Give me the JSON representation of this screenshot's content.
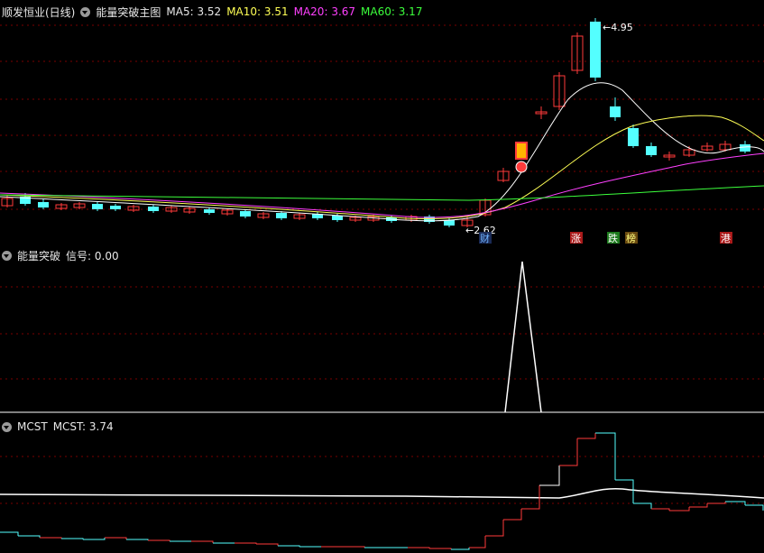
{
  "main_pane": {
    "stock_title": "顺发恒业(日线)",
    "indicator_name": "能量突破主图",
    "ma": [
      {
        "label": "MA5:",
        "value": "3.52",
        "color": "#ffffff"
      },
      {
        "label": "MA10:",
        "value": "3.51",
        "color": "#ffff55"
      },
      {
        "label": "MA20:",
        "value": "3.67",
        "color": "#ff40ff"
      },
      {
        "label": "MA60:",
        "value": "3.17",
        "color": "#3cff3c"
      }
    ],
    "high_marker": "4.95",
    "low_marker": "2.62",
    "event_labels": [
      {
        "text": "财",
        "color": "#6fb3ff",
        "bg": "#1a2a55"
      },
      {
        "text": "涨",
        "color": "#ffffff",
        "bg": "#aa1a1a"
      },
      {
        "text": "跌",
        "color": "#ffffff",
        "bg": "#1d7a1d"
      },
      {
        "text": "榜",
        "color": "#ffff80",
        "bg": "#6a4a10"
      },
      {
        "text": "港",
        "color": "#ffffff",
        "bg": "#aa1a1a"
      }
    ]
  },
  "signal_pane": {
    "indicator_name": "能量突破",
    "signal_label": "信号:",
    "signal_value": "0.00"
  },
  "mcst_pane": {
    "indicator_name": "MCST",
    "mcst_label": "MCST:",
    "mcst_value": "3.74"
  },
  "colors": {
    "up": "#ff3a3a",
    "down": "#54ffff",
    "grid": "#7a0000",
    "ma5": "#ffffff",
    "ma10": "#ffff55",
    "ma20": "#ff40ff",
    "ma60": "#3cff3c"
  }
}
